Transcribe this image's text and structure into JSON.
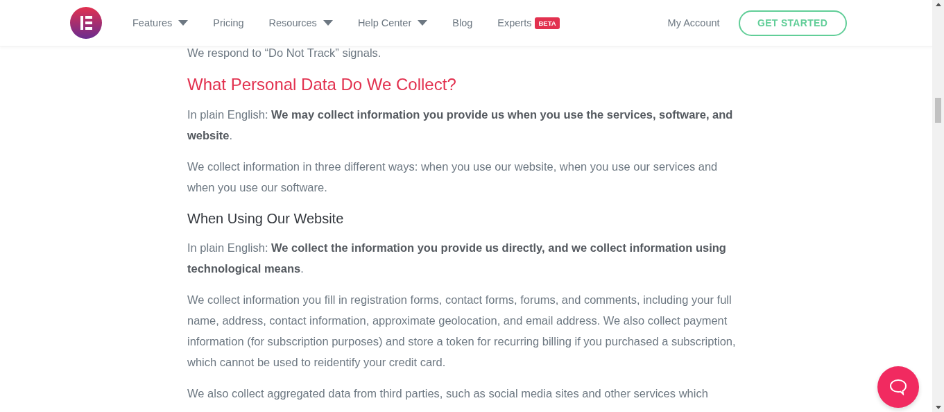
{
  "nav": {
    "items": [
      {
        "label": "Features",
        "dropdown": true
      },
      {
        "label": "Pricing",
        "dropdown": false
      },
      {
        "label": "Resources",
        "dropdown": true
      },
      {
        "label": "Help Center",
        "dropdown": true
      },
      {
        "label": "Blog",
        "dropdown": false
      },
      {
        "label": "Experts",
        "dropdown": false,
        "badge": "BETA"
      }
    ],
    "account": "My Account",
    "cta": "GET STARTED"
  },
  "content": [
    {
      "kind": "paragraph",
      "text": "We respond to “Do Not Track” signals."
    },
    {
      "kind": "heading",
      "text": "What Personal Data Do We Collect?"
    },
    {
      "kind": "paragraph",
      "text": "In plain English: **We may collect information you provide us when you use the services, software, and website**."
    },
    {
      "kind": "paragraph",
      "text": "We collect information in three different ways: when you use our website, when you use our services and when you use our software."
    },
    {
      "kind": "subheading",
      "text": "When Using Our Website"
    },
    {
      "kind": "paragraph",
      "text": "In plain English: **We collect the information you provide us directly, and we collect information using technological means**."
    },
    {
      "kind": "paragraph",
      "text": "We collect information you fill in registration forms, contact forms, forums, and comments, including your full name, address, contact information, approximate geolocation, and email address. We also collect payment information (for subscription purposes) and store a token for recurring billing if you purchased a subscription, which cannot be used to reidentify your credit card."
    },
    {
      "kind": "paragraph",
      "text": "We also collect aggregated data from third parties, such as social media sites and other services which"
    }
  ]
}
